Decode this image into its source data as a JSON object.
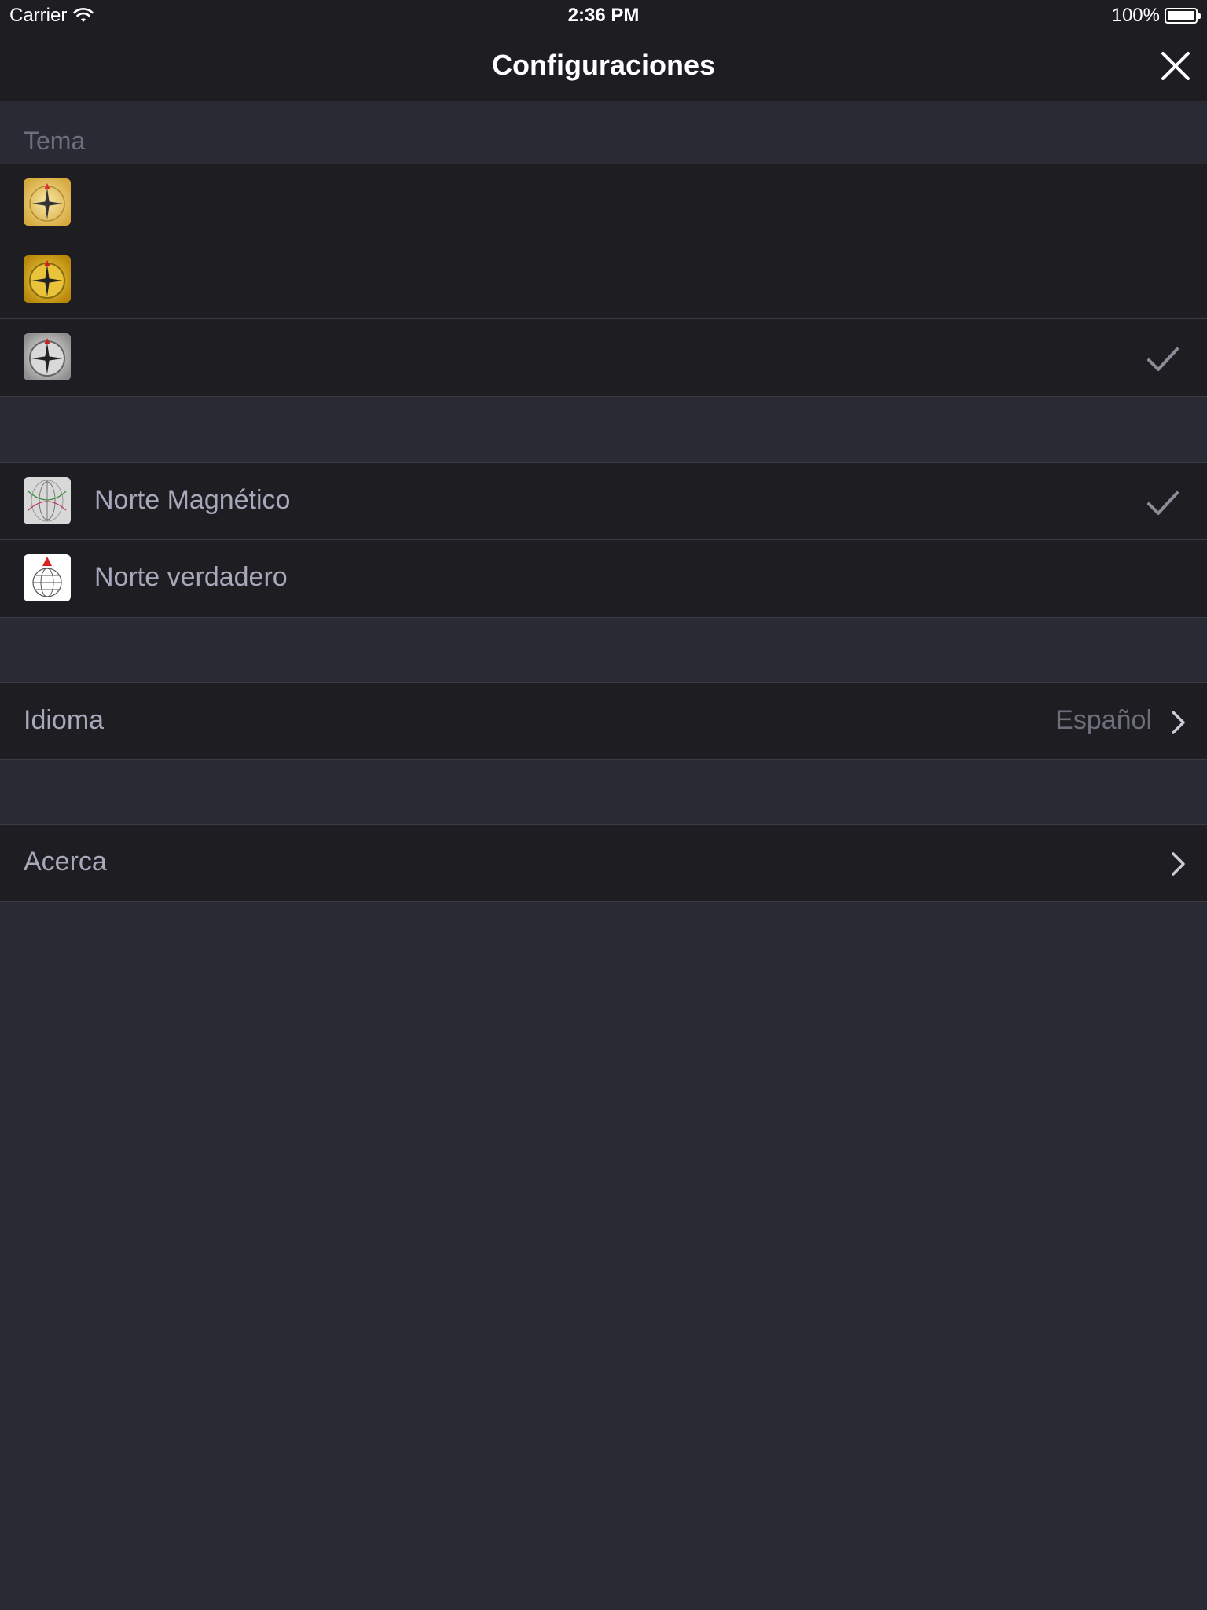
{
  "status_bar": {
    "carrier": "Carrier",
    "time": "2:36 PM",
    "battery": "100%"
  },
  "nav": {
    "title": "Configuraciones",
    "close_icon": "close-icon"
  },
  "theme_section": {
    "header": "Tema",
    "items": [
      {
        "icon": "compass-gold-icon",
        "selected": false
      },
      {
        "icon": "compass-yellow-icon",
        "selected": false
      },
      {
        "icon": "compass-silver-icon",
        "selected": true
      }
    ]
  },
  "north_section": {
    "items": [
      {
        "label": "Norte Magnético",
        "icon": "magnetic-field-icon",
        "selected": true
      },
      {
        "label": "Norte verdadero",
        "icon": "globe-north-icon",
        "selected": false
      }
    ]
  },
  "language": {
    "label": "Idioma",
    "value": "Español"
  },
  "about": {
    "label": "Acerca"
  },
  "colors": {
    "background": "#292a33",
    "cell": "#1d1d22",
    "text": "#a7a8ba",
    "muted": "#6e6f7d"
  }
}
